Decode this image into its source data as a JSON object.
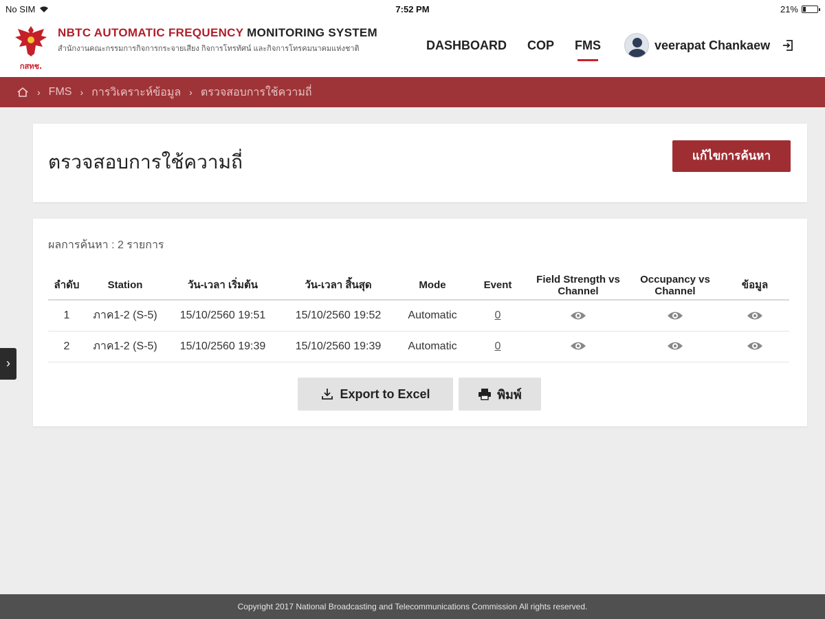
{
  "status_bar": {
    "carrier": "No SIM",
    "time": "7:52 PM",
    "battery": "21%",
    "battery_level": 0.21
  },
  "header": {
    "title_red": "NBTC AUTOMATIC FREQUENCY",
    "title_dark": "MONITORING SYSTEM",
    "subtitle": "สำนักงานคณะกรรมการกิจการกระจายเสียง กิจการโทรทัศน์ และกิจการโทรคมนาคมแห่งชาติ",
    "logo_text": "กสทช.",
    "nav": [
      {
        "label": "DASHBOARD",
        "active": false
      },
      {
        "label": "COP",
        "active": false
      },
      {
        "label": "FMS",
        "active": true
      }
    ],
    "user_name": "veerapat Chankaew"
  },
  "breadcrumb": {
    "items": [
      "FMS",
      "การวิเคราะห์ข้อมูล",
      "ตรวจสอบการใช้ความถี่"
    ]
  },
  "page": {
    "title": "ตรวจสอบการใช้ความถี่",
    "edit_search_button": "แก้ไขการค้นหา",
    "result_count": "ผลการค้นหา : 2 รายการ"
  },
  "table": {
    "columns": [
      "ลำดับ",
      "Station",
      "วัน-เวลา เริ่มต้น",
      "วัน-เวลา สิ้นสุด",
      "Mode",
      "Event",
      "Field Strength vs Channel",
      "Occupancy vs Channel",
      "ข้อมูล"
    ],
    "rows": [
      {
        "no": "1",
        "station": "ภาค1-2 (S-5)",
        "start": "15/10/2560 19:51",
        "end": "15/10/2560 19:52",
        "mode": "Automatic",
        "event": "0"
      },
      {
        "no": "2",
        "station": "ภาค1-2 (S-5)",
        "start": "15/10/2560 19:39",
        "end": "15/10/2560 19:39",
        "mode": "Automatic",
        "event": "0"
      }
    ]
  },
  "actions": {
    "export_label": "Export to Excel",
    "print_label": "พิมพ์"
  },
  "footer": {
    "copyright": "Copyright 2017 National Broadcasting and Telecommunications Commission All rights reserved."
  },
  "colors": {
    "brand_red": "#9f2e33",
    "breadcrumb_bg": "#9f3438",
    "nav_active": "#c8202c"
  }
}
